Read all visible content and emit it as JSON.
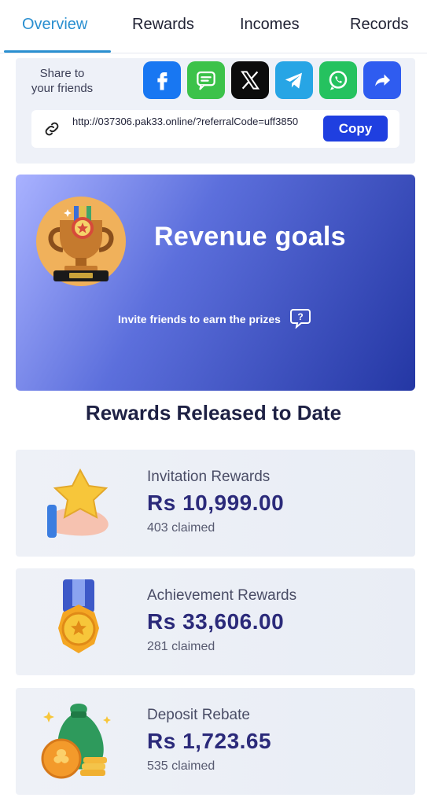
{
  "tabs": [
    {
      "label": "Overview",
      "active": true
    },
    {
      "label": "Rewards",
      "active": false
    },
    {
      "label": "Incomes",
      "active": false
    },
    {
      "label": "Records",
      "active": false
    }
  ],
  "share": {
    "label": "Share to your friends",
    "icons": [
      "facebook-icon",
      "sms-icon",
      "x-icon",
      "telegram-icon",
      "whatsapp-icon",
      "share-icon"
    ],
    "link": "http://037306.pak33.online/?referralCode=uff3850",
    "copy_label": "Copy"
  },
  "banner": {
    "title": "Revenue goals",
    "subtitle": "Invite friends to earn the prizes",
    "help_glyph": "?"
  },
  "section_title": "Rewards Released to Date",
  "rewards": [
    {
      "title": "Invitation Rewards",
      "amount": "Rs  10,999.00",
      "claimed": "403 claimed"
    },
    {
      "title": "Achievement Rewards",
      "amount": "Rs  33,606.00",
      "claimed": "281 claimed"
    },
    {
      "title": "Deposit Rebate",
      "amount": "Rs  1,723.65",
      "claimed": "535 claimed"
    }
  ],
  "colors": {
    "accent": "#2a8fd0",
    "copy_button": "#1f3fe0",
    "amount": "#2b2a7a"
  }
}
